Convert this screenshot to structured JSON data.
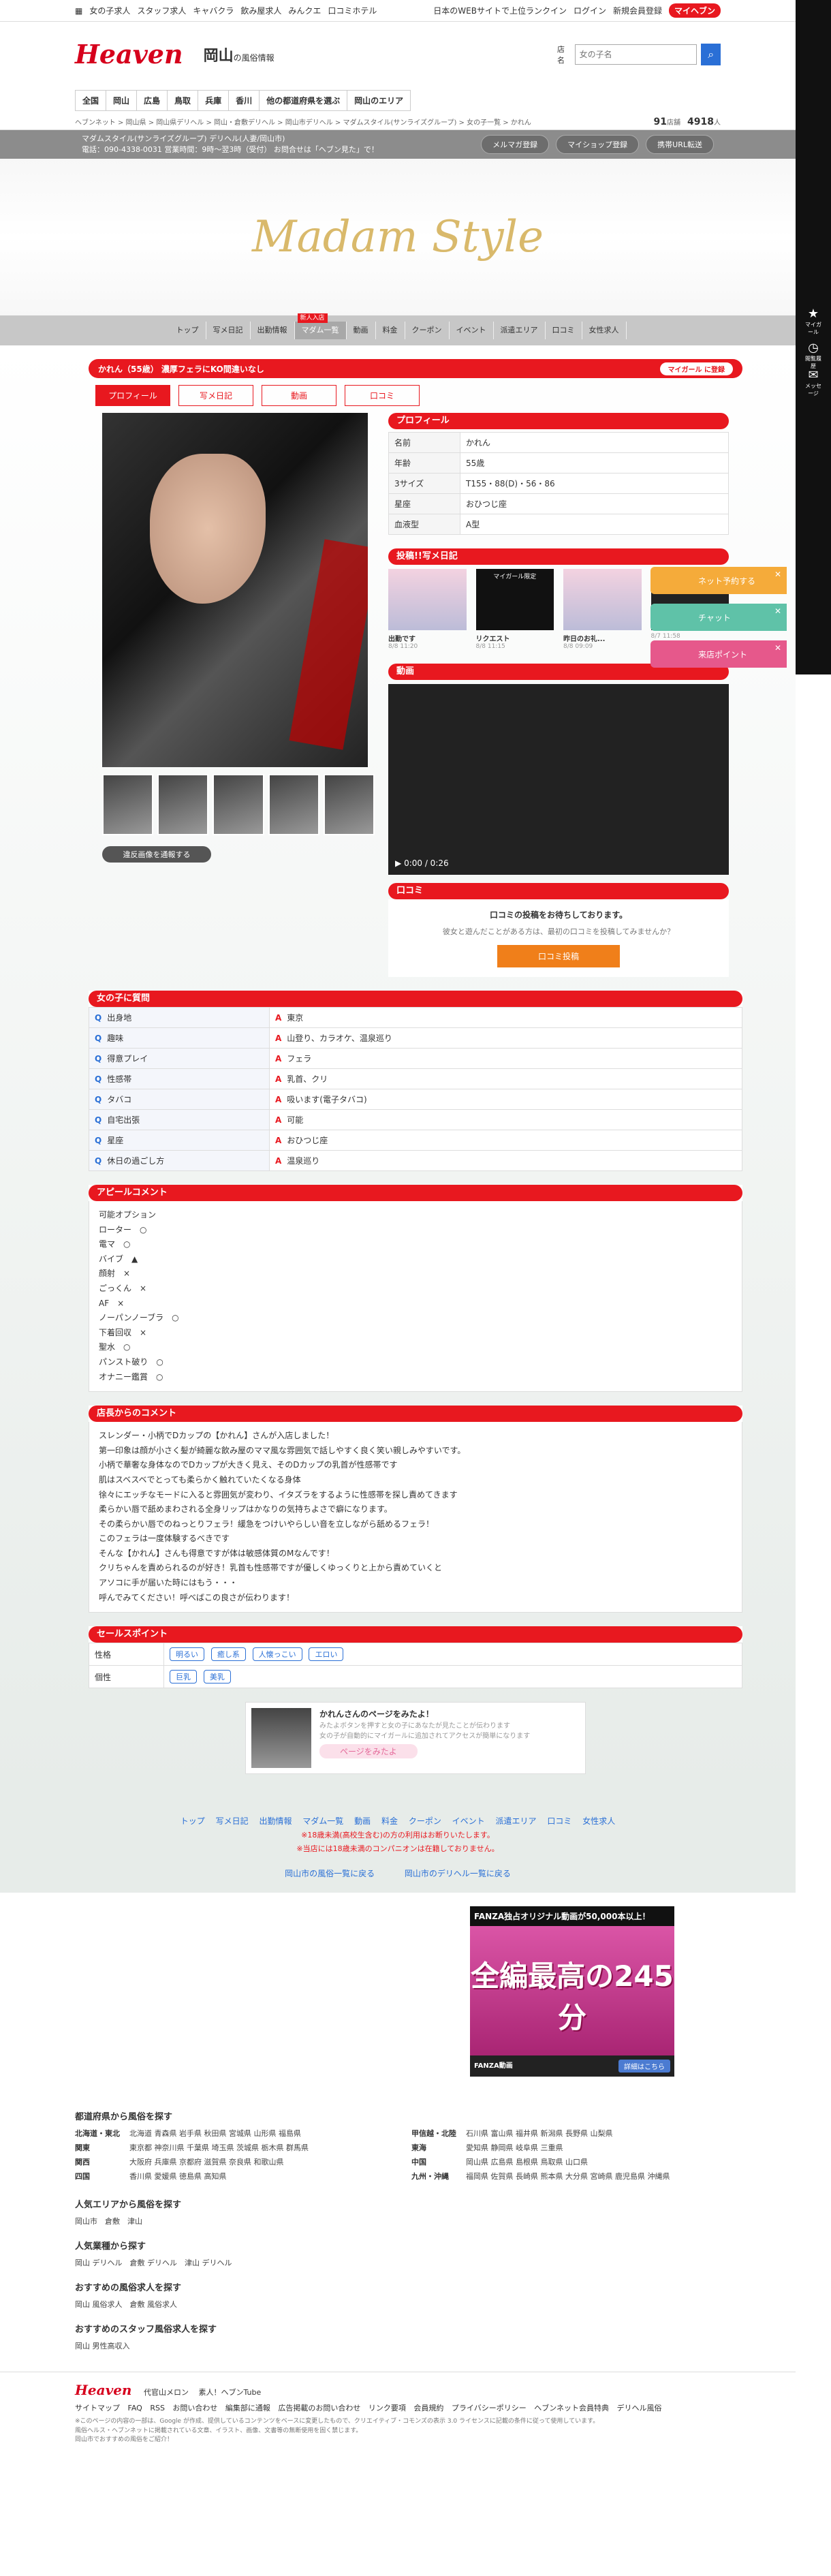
{
  "topbar": {
    "links": [
      "女の子求人",
      "スタッフ求人",
      "キャバクラ",
      "飲み屋求人",
      "みんクエ",
      "口コミホテル"
    ],
    "right": [
      "日本のWEBサイトで上位ランクイン",
      "ログイン",
      "新規会員登録"
    ],
    "my": "マイヘブン"
  },
  "header": {
    "logo": "Heaven",
    "area": "岡山",
    "area_sub": "の風俗情報",
    "search_label": "店名",
    "search_placeholder": "女の子名"
  },
  "navrow": [
    "全国",
    "岡山",
    "広島",
    "鳥取",
    "兵庫",
    "香川",
    "他の都道府県を選ぶ",
    "岡山のエリア"
  ],
  "breadcrumb": {
    "path": "ヘブンネット > 岡山県 > 岡山県デリヘル > 岡山・倉敷デリヘル > 岡山市デリヘル > マダムスタイル(サンライズグループ) > 女の子一覧 > かれん",
    "count1": "91",
    "count1_unit": "店舗",
    "count2": "4918",
    "count2_unit": "人"
  },
  "shop": {
    "name": "マダムスタイル(サンライズグループ) デリヘル(人妻/岡山市)",
    "info": "電話：090-4338-0031 営業時間：9時～翌3時（受付） お問合せは「ヘブン見た」で！",
    "buttons": [
      "メルマガ登録",
      "マイショップ登録",
      "携帯URL転送"
    ],
    "brand": "Madam Style"
  },
  "shopnav": {
    "items": [
      "トップ",
      "写メ日記",
      "出勤情報",
      "マダム一覧",
      "動画",
      "料金",
      "クーポン",
      "イベント",
      "派遣エリア",
      "口コミ",
      "女性求人"
    ],
    "badge": "新人入店"
  },
  "profile": {
    "title": "かれん（55歳） 濃厚フェラにKO間違いなし",
    "mygirl": "マイガール に登録",
    "tabs": [
      "プロフィール",
      "写メ日記",
      "動画",
      "口コミ"
    ],
    "notify": "違反画像を通報する"
  },
  "profile_table": {
    "title": "プロフィール",
    "rows": [
      [
        "名前",
        "かれん"
      ],
      [
        "年齢",
        "55歳"
      ],
      [
        "3サイズ",
        "T155・88(D)・56・86"
      ],
      [
        "星座",
        "おひつじ座"
      ],
      [
        "血液型",
        "A型"
      ]
    ]
  },
  "diary": {
    "title": "投稿!!写メ日記",
    "cards": [
      {
        "t": "出勤です",
        "d": "8/8 11:20"
      },
      {
        "t": "リクエスト",
        "d": "8/8 11:15"
      },
      {
        "t": "昨日のお礼...",
        "d": "8/8 09:09"
      },
      {
        "t": "",
        "d": "8/7 11:58"
      }
    ],
    "badge": "マイガール限定"
  },
  "video": {
    "title": "動画",
    "time": "0:00 / 0:26"
  },
  "kuchikomi": {
    "title": "口コミ",
    "main": "口コミの投稿をお待ちしております。",
    "sub": "彼女と遊んだことがある方は、最初の口コミを投稿してみませんか？",
    "btn": "口コミ投稿"
  },
  "qa": {
    "title": "女の子に質問",
    "rows": [
      [
        "出身地",
        "東京"
      ],
      [
        "趣味",
        "山登り、カラオケ、温泉巡り"
      ],
      [
        "得意プレイ",
        "フェラ"
      ],
      [
        "性感帯",
        "乳首、クリ"
      ],
      [
        "タバコ",
        "吸います(電子タバコ)"
      ],
      [
        "自宅出張",
        "可能"
      ],
      [
        "星座",
        "おひつじ座"
      ],
      [
        "休日の過ごし方",
        "温泉巡り"
      ]
    ]
  },
  "appeal": {
    "title": "アピールコメント",
    "text": "可能オプション\nローター　○\n電マ　○\nバイブ　▲\n顔射　×\nごっくん　×\nAF　×\nノーパンノーブラ　○\n下着回収　×\n聖水　○\nパンスト破り　○\nオナニー鑑賞　○"
  },
  "staff": {
    "title": "店長からのコメント",
    "text": "スレンダー・小柄でDカップの【かれん】さんが入店しました！\n第一印象は顔が小さく髪が綺麗な飲み屋のママ風な雰囲気で話しやすく良く笑い親しみやすいです。\n小柄で華奢な身体なのでDカップが大きく見え、そのDカップの乳首が性感帯です\n肌はスベスベでとっても柔らかく触れていたくなる身体\n徐々にエッチなモードに入ると雰囲気が変わり、イタズラをするように性感帯を探し責めてきます\n柔らかい唇で舐めまわされる全身リップはかなりの気持ちよさで癖になります。\nその柔らかい唇でのねっとりフェラ！緩急をつけいやらしい音を立しながら舐めるフェラ！\nこのフェラは一度体験するべきです\nそんな【かれん】さんも得意ですが体は敏感体質のMなんです！\nクリちゃんを責められるのが好き！乳首も性感帯ですが優しくゆっくりと上から責めていくと\nアソコに手が届いた時にはもう・・・\n呼んでみてください！呼べばこの良さが伝わります！"
  },
  "sales": {
    "title": "セールスポイント",
    "rows": [
      {
        "k": "性格",
        "tags": [
          "明るい",
          "癒し系",
          "人懐っこい",
          "エロい"
        ]
      },
      {
        "k": "個性",
        "tags": [
          "巨乳",
          "美乳"
        ]
      }
    ]
  },
  "visit": {
    "t1": "かれんさんのページをみたよ！",
    "t2": "みたよボタンを押すと女の子にあなたが見たことが伝わります\n女の子が自動的にマイガールに追加されてアクセスが簡単になります",
    "btn": "ページをみたよ"
  },
  "footnav": {
    "links": [
      "トップ",
      "写メ日記",
      "出勤情報",
      "マダム一覧",
      "動画",
      "料金",
      "クーポン",
      "イベント",
      "派遣エリア",
      "口コミ",
      "女性求人"
    ],
    "red1": "※18歳未満(高校生含む)の方の利用はお断りいたします。",
    "red2": "※当店には18歳未満のコンパニオンは在籍しておりません。",
    "links2": [
      "岡山市の風俗一覧に戻る",
      "岡山市のデリヘル一覧に戻る"
    ]
  },
  "ad": {
    "top": "FANZA独占オリジナル動画が50,000本以上！",
    "big": "全編最高の245分",
    "bot": "FANZA動画",
    "btn": "詳細はこちら"
  },
  "sitemap": {
    "h1": "都道府県から風俗を探す",
    "regions": [
      {
        "k": "北海道・東北",
        "v": "北海道 青森県 岩手県 秋田県 宮城県 山形県 福島県"
      },
      {
        "k": "関東",
        "v": "東京都 神奈川県 千葉県 埼玉県 茨城県 栃木県 群馬県"
      },
      {
        "k": "関西",
        "v": "大阪府 兵庫県 京都府 滋賀県 奈良県 和歌山県"
      },
      {
        "k": "四国",
        "v": "香川県 愛媛県 徳島県 高知県"
      },
      {
        "k": "甲信越・北陸",
        "v": "石川県 富山県 福井県 新潟県 長野県 山梨県"
      },
      {
        "k": "東海",
        "v": "愛知県 静岡県 岐阜県 三重県"
      },
      {
        "k": "中国",
        "v": "岡山県 広島県 島根県 鳥取県 山口県"
      },
      {
        "k": "九州・沖縄",
        "v": "福岡県 佐賀県 長崎県 熊本県 大分県 宮崎県 鹿児島県 沖縄県"
      }
    ],
    "h2": "人気エリアから風俗を探す",
    "l2": "岡山市　倉敷　津山",
    "h3": "人気業種から探す",
    "l3": "岡山 デリヘル　倉敷 デリヘル　津山 デリヘル",
    "h4": "おすすめの風俗求人を探す",
    "l4": "岡山 風俗求人　倉敷 風俗求人",
    "h5": "おすすめのスタッフ風俗求人を探す",
    "l5": "岡山 男性高収入"
  },
  "footer": {
    "logo": "Heaven",
    "icons": [
      "代官山メロン",
      "素人！ヘブンTube"
    ],
    "links": [
      "サイトマップ",
      "FAQ",
      "RSS",
      "お問い合わせ",
      "編集部に通報",
      "広告掲載のお問い合わせ",
      "リンク要項",
      "会員規約",
      "プライバシーポリシー",
      "ヘブンネット会員特典",
      "デリヘル風俗"
    ],
    "copy": "※このページの内容の一部は、Google が作成、提供しているコンテンツをベースに変更したもので、クリエイティブ・コモンズの表示 3.0 ライセンスに記載の条件に従って使用しています。\n風俗ヘルス・ヘブンネットに掲載されている文章、イラスト、画像、文書等の無断使用を固く禁じます。\n岡山市でおすすめの風俗をご紹介！"
  },
  "floatbtns": [
    "ネット予約する",
    "チャット",
    "来店ポイント"
  ],
  "side": [
    {
      "icon": "★",
      "label": "マイガール"
    },
    {
      "icon": "◷",
      "label": "閲覧履歴"
    },
    {
      "icon": "✉",
      "label": "メッセージ"
    }
  ]
}
